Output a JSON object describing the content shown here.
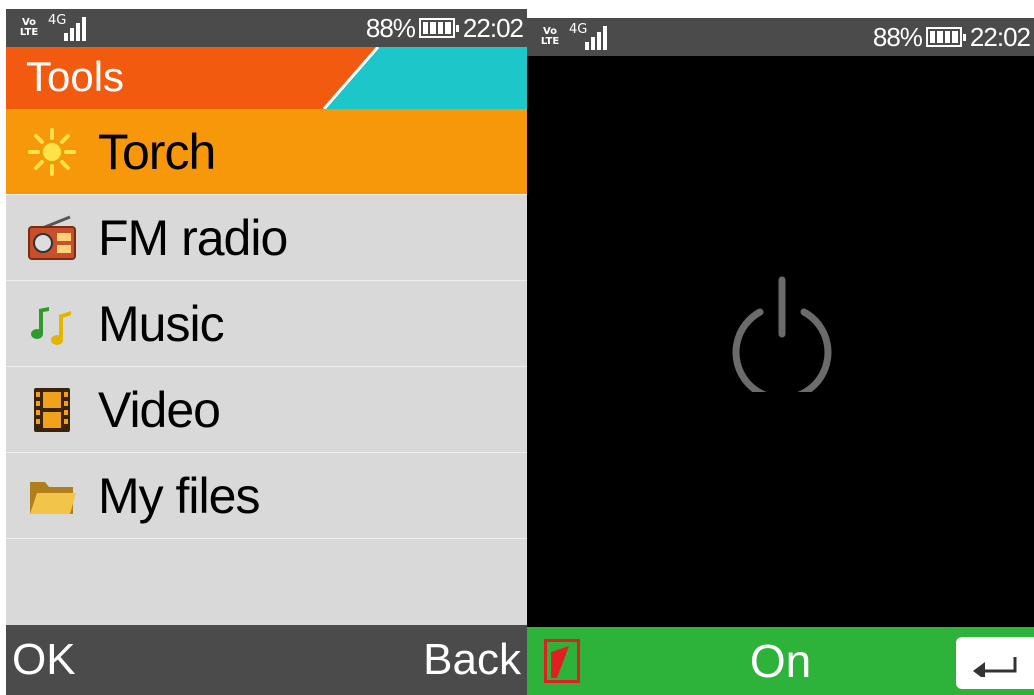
{
  "status": {
    "network": "Vo LTE",
    "signal_type": "4G",
    "battery_percent": "88%",
    "battery_level": 0.88,
    "time": "22:02"
  },
  "tools_screen": {
    "title": "Tools",
    "title_colors": {
      "orange": "#f15a0f",
      "teal": "#1cc6c9"
    },
    "items": [
      {
        "label": "Torch",
        "icon": "sun-icon",
        "selected": true
      },
      {
        "label": "FM radio",
        "icon": "radio-icon",
        "selected": false
      },
      {
        "label": "Music",
        "icon": "music-notes-icon",
        "selected": false
      },
      {
        "label": "Video",
        "icon": "film-icon",
        "selected": false
      },
      {
        "label": "My files",
        "icon": "folder-icon",
        "selected": false
      }
    ],
    "softkeys": {
      "left": "OK",
      "right": "Back"
    }
  },
  "torch_screen": {
    "icon": "power-icon",
    "center_softkey": "On",
    "back_icon": "return-arrow-icon",
    "accent": "#2db33a"
  }
}
